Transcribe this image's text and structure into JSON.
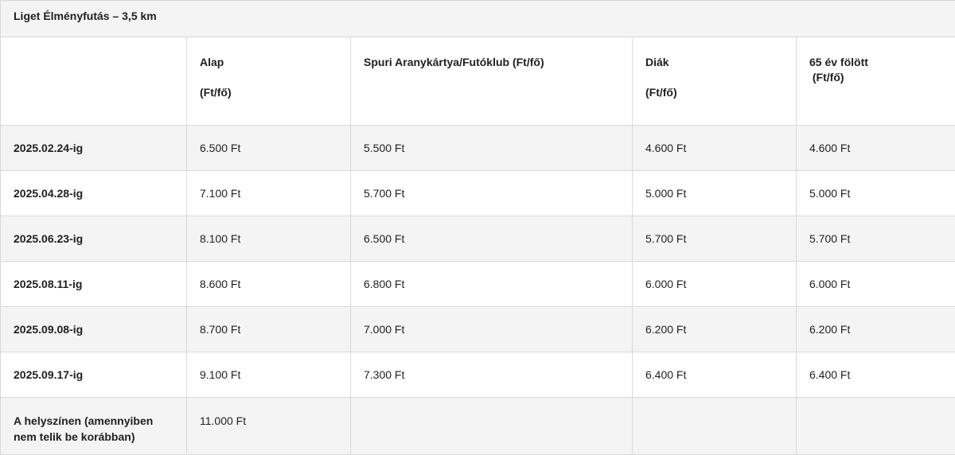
{
  "title": "Liget Élményfutás – 3,5 km",
  "headers": [
    {
      "line1": "Alap",
      "line2": "(Ft/fő)"
    },
    {
      "line1": "Spuri Aranykártya/Futóklub (Ft/fő)",
      "line2": ""
    },
    {
      "line1": "Diák",
      "line2": "(Ft/fő)"
    },
    {
      "line1": "65 év fölött",
      "line2": " (Ft/fő)"
    }
  ],
  "rows": [
    {
      "label": "2025.02.24-ig",
      "values": [
        "6.500 Ft",
        "5.500 Ft",
        "4.600 Ft",
        "4.600 Ft"
      ]
    },
    {
      "label": "2025.04.28-ig",
      "values": [
        "7.100 Ft",
        "5.700 Ft",
        "5.000 Ft",
        "5.000 Ft"
      ]
    },
    {
      "label": "2025.06.23-ig",
      "values": [
        "8.100 Ft",
        "6.500 Ft",
        "5.700 Ft",
        "5.700 Ft"
      ]
    },
    {
      "label": "2025.08.11-ig",
      "values": [
        "8.600 Ft",
        "6.800 Ft",
        "6.000 Ft",
        "6.000 Ft"
      ]
    },
    {
      "label": "2025.09.08-ig",
      "values": [
        "8.700 Ft",
        "7.000 Ft",
        "6.200 Ft",
        "6.200 Ft"
      ]
    },
    {
      "label": "2025.09.17-ig",
      "values": [
        "9.100 Ft",
        "7.300 Ft",
        "6.400 Ft",
        "6.400 Ft"
      ]
    }
  ],
  "last_row": {
    "label": "A helyszínen (amennyiben nem telik be korábban)",
    "values": [
      "11.000 Ft",
      "",
      "",
      ""
    ]
  }
}
